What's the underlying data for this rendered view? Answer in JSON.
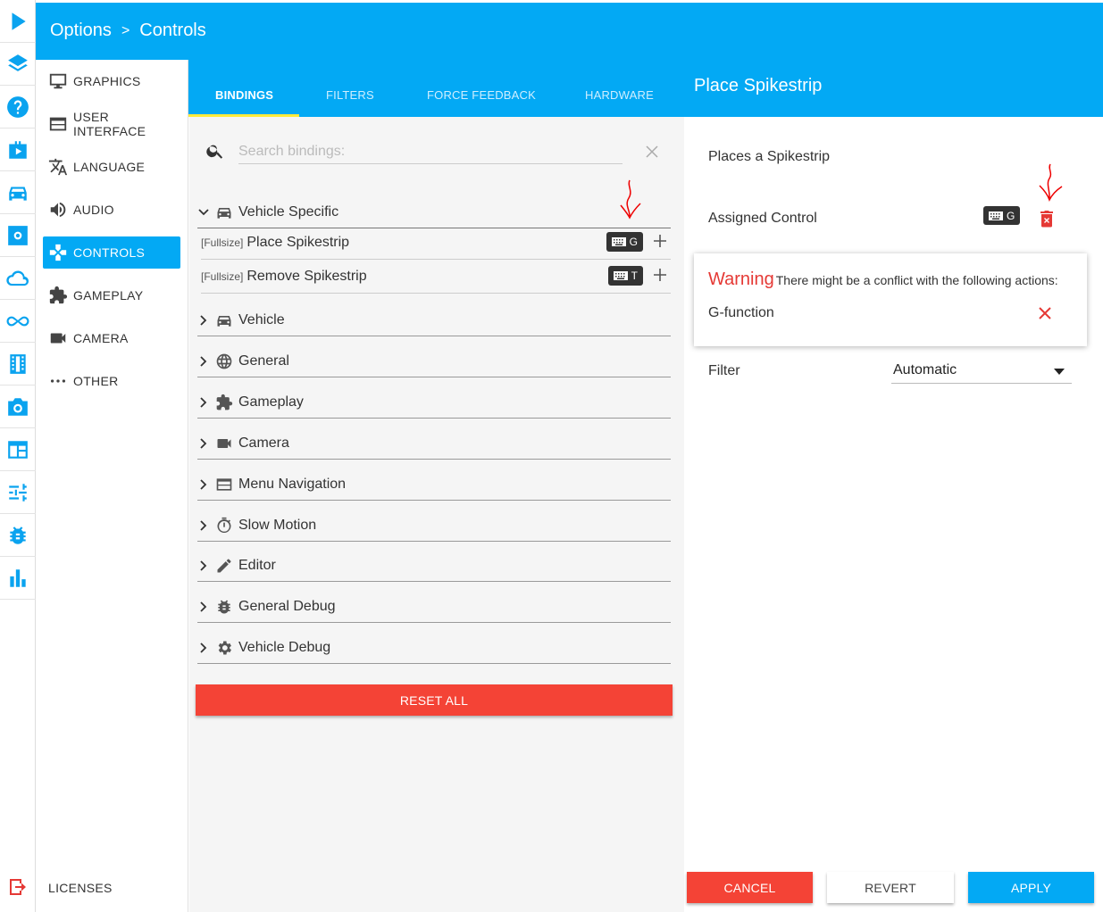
{
  "header": {
    "breadcrumb": [
      "Options",
      ">",
      "Controls"
    ]
  },
  "rail": {
    "icons": [
      "play-icon",
      "layers-icon",
      "help-icon",
      "briefcase-icon",
      "car-icon",
      "settings-icon",
      "cloud-icon",
      "infinity-icon",
      "film-icon",
      "camera-icon",
      "window-icon",
      "sliders-icon",
      "bug-icon",
      "bar-chart-icon",
      "exit-icon"
    ]
  },
  "menu": {
    "items": [
      {
        "label": "GRAPHICS",
        "icon": "monitor-icon"
      },
      {
        "label": "USER INTERFACE",
        "icon": "window-icon"
      },
      {
        "label": "LANGUAGE",
        "icon": "translate-icon"
      },
      {
        "label": "AUDIO",
        "icon": "volume-icon"
      },
      {
        "label": "CONTROLS",
        "icon": "gamepad-icon",
        "active": true
      },
      {
        "label": "GAMEPLAY",
        "icon": "puzzle-icon"
      },
      {
        "label": "CAMERA",
        "icon": "videocam-icon"
      },
      {
        "label": "OTHER",
        "icon": "more-horiz-icon"
      }
    ],
    "licenses": "LICENSES"
  },
  "tabs": [
    {
      "label": "BINDINGS",
      "active": true
    },
    {
      "label": "FILTERS"
    },
    {
      "label": "FORCE FEEDBACK"
    },
    {
      "label": "HARDWARE"
    }
  ],
  "search": {
    "placeholder": "Search bindings:",
    "value": ""
  },
  "groups": {
    "open": {
      "label": "Vehicle Specific",
      "icon": "car-icon"
    },
    "bindings": [
      {
        "prefix": "[Fullsize]",
        "label": "Place Spikestrip",
        "key": "G"
      },
      {
        "prefix": "[Fullsize]",
        "label": "Remove Spikestrip",
        "key": "T"
      }
    ],
    "collapsed": [
      {
        "label": "Vehicle",
        "icon": "car-icon"
      },
      {
        "label": "General",
        "icon": "globe-icon"
      },
      {
        "label": "Gameplay",
        "icon": "puzzle-icon"
      },
      {
        "label": "Camera",
        "icon": "videocam-icon"
      },
      {
        "label": "Menu Navigation",
        "icon": "window-icon"
      },
      {
        "label": "Slow Motion",
        "icon": "timer-icon"
      },
      {
        "label": "Editor",
        "icon": "pencil-icon"
      },
      {
        "label": "General Debug",
        "icon": "bug-icon"
      },
      {
        "label": "Vehicle Debug",
        "icon": "gear-icon"
      }
    ]
  },
  "reset_all": "RESET ALL",
  "detail": {
    "title": "Place Spikestrip",
    "description": "Places a Spikestrip",
    "assigned_label": "Assigned Control",
    "assigned_key": "G",
    "warning": {
      "title": "Warning",
      "message": "There might be a conflict with the following actions:",
      "conflict": "G-function"
    },
    "filter_label": "Filter",
    "filter_value": "Automatic"
  },
  "footer": {
    "cancel": "CANCEL",
    "revert": "REVERT",
    "apply": "APPLY"
  },
  "colors": {
    "accent": "#03a9f4",
    "danger": "#f44336",
    "tab_underline": "#ffeb3b",
    "key_chip": "#333333"
  }
}
